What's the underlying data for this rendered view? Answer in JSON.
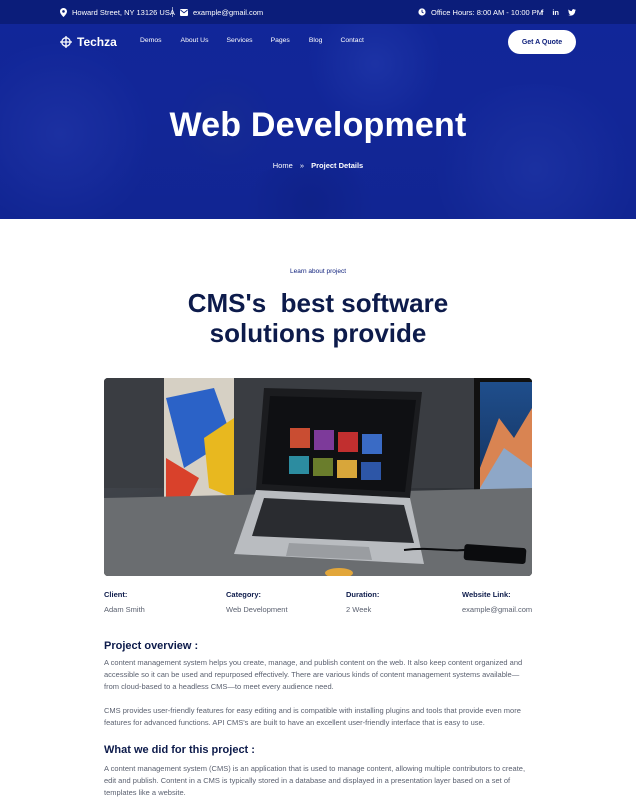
{
  "topbar": {
    "address": "Howard Street, NY 13126 USA",
    "email": "example@gmail.com",
    "office_hours": "Office Hours: 8:00 AM - 10:00 PM",
    "socials": [
      "f",
      "in",
      "twitter-icon"
    ]
  },
  "header": {
    "logo": "Techza",
    "nav": [
      "Demos",
      "About Us",
      "Services",
      "Pages",
      "Blog",
      "Contact"
    ],
    "cta": "Get A Quote"
  },
  "hero": {
    "title": "Web Development",
    "breadcrumb": {
      "home": "Home",
      "separator": "»",
      "current": "Project Details"
    }
  },
  "main": {
    "eyebrow": "Learn about project",
    "headline_line1": "CMS's  best software",
    "headline_line2": "solutions provide",
    "details": [
      {
        "label": "Client:",
        "value": "Adam Smith"
      },
      {
        "label": "Category:",
        "value": "Web Development"
      },
      {
        "label": "Duration:",
        "value": "2 Week"
      },
      {
        "label": "Website Link:",
        "value": "example@gmail.com"
      }
    ],
    "overview": {
      "heading": "Project overview :",
      "p1": "A content management system helps you create, manage, and publish content on the web. It also keep content organized and accessible so it can be used and repurposed effectively. There are various kinds of content management systems available—from cloud-based to a headless CMS—to meet every audience need.",
      "p2": "CMS provides user-friendly features for easy editing and is compatible with installing plugins and tools that provide even more features for advanced functions. API CMS's are built to have an excellent user-friendly interface that is easy to use."
    },
    "work": {
      "heading": "What we did for this project :",
      "p1": "A content management system (CMS) is an application that is used to manage content, allowing multiple contributors to create, edit and publish. Content in a CMS is typically stored in a database and displayed in a presentation layer based on a set of templates like a website."
    }
  },
  "colors": {
    "brand_dark": "#0b1d7a",
    "hero_blue": "#13299d",
    "heading": "#0d1b4b",
    "body_text": "#5b6170"
  }
}
